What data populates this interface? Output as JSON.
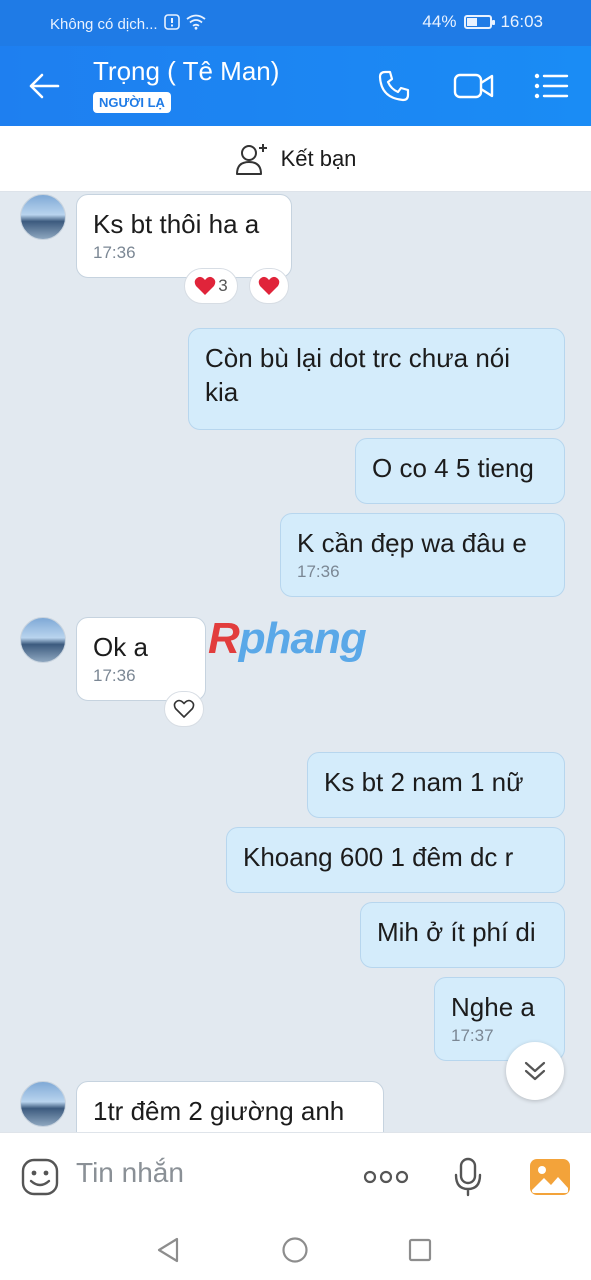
{
  "status_bar": {
    "carrier": "Không có dịch...",
    "battery": "44%",
    "battery_level": 0.44,
    "time": "16:03"
  },
  "header": {
    "title": "Trọng ( Tê Man)",
    "badge": "NGƯỜI LẠ"
  },
  "friend_bar": {
    "label": "Kết bạn"
  },
  "messages": [
    {
      "side": "in",
      "text": "Ks bt thôi ha a",
      "time": "17:36",
      "reaction_count": "3"
    },
    {
      "side": "out",
      "text": "Còn bù lại dot trc chưa nói kia"
    },
    {
      "side": "out",
      "text": "O co 4 5 tieng"
    },
    {
      "side": "out",
      "text": "K cần đẹp wa đâu e",
      "time": "17:36"
    },
    {
      "side": "in",
      "text": "Ok a",
      "time": "17:36"
    },
    {
      "side": "out",
      "text": "Ks bt 2 nam 1 nữ"
    },
    {
      "side": "out",
      "text": "Khoang 600 1 đêm dc r"
    },
    {
      "side": "out",
      "text": "Mih ở ít phí di"
    },
    {
      "side": "out",
      "text": "Nghe a",
      "time": "17:37"
    },
    {
      "side": "in",
      "text": "1tr đêm 2 giường anh"
    }
  ],
  "watermark": {
    "first": "R",
    "rest": "phang"
  },
  "input": {
    "placeholder": "Tin nhắn"
  },
  "colors": {
    "accent": "#1f7be6",
    "out_bubble": "#d4ecfb",
    "heart": "#e0243a"
  }
}
